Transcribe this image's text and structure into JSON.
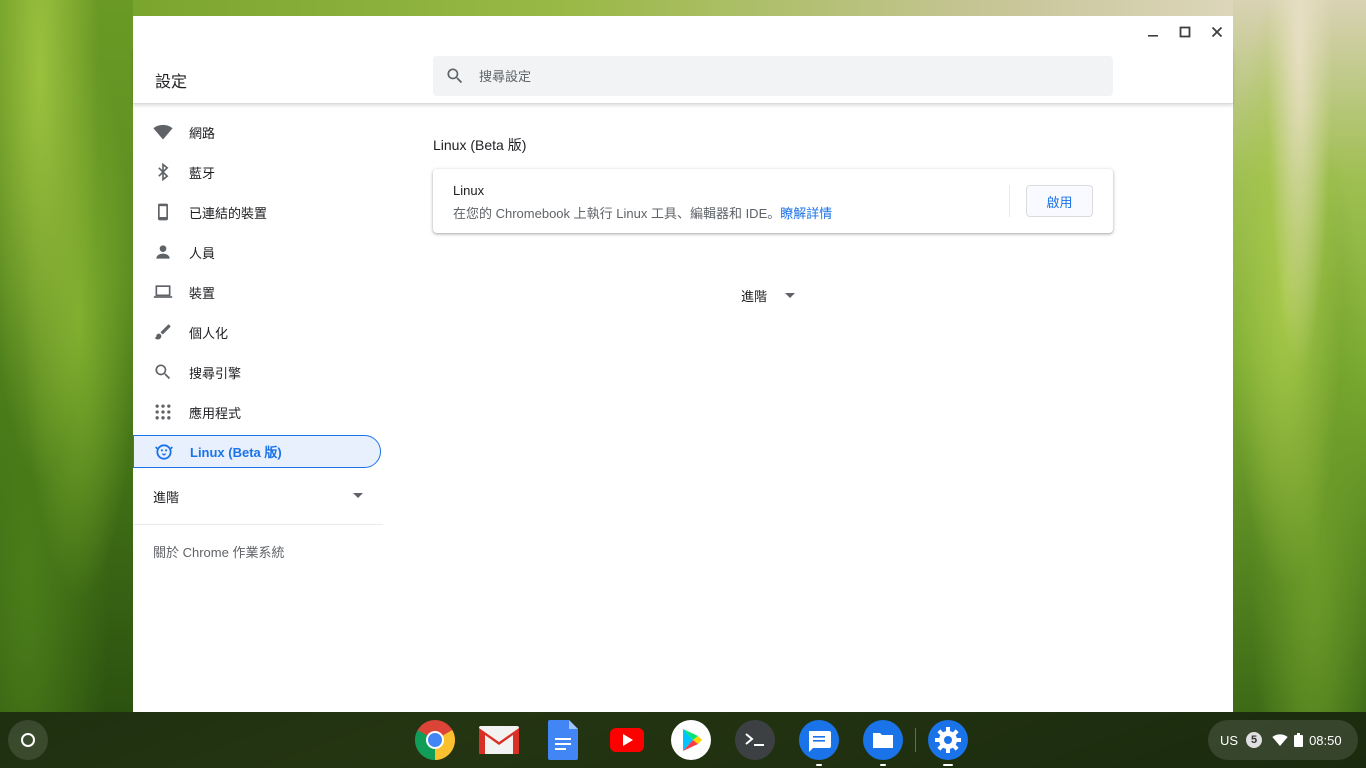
{
  "window": {
    "app_title": "設定",
    "search_placeholder": "搜尋設定",
    "controls": [
      "minimize",
      "maximize",
      "close"
    ]
  },
  "sidebar": {
    "items": [
      {
        "label": "網路",
        "icon": "wifi-icon"
      },
      {
        "label": "藍牙",
        "icon": "bluetooth-icon"
      },
      {
        "label": "已連結的裝置",
        "icon": "phone-icon"
      },
      {
        "label": "人員",
        "icon": "person-icon"
      },
      {
        "label": "裝置",
        "icon": "laptop-icon"
      },
      {
        "label": "個人化",
        "icon": "brush-icon"
      },
      {
        "label": "搜尋引擎",
        "icon": "search-icon"
      },
      {
        "label": "應用程式",
        "icon": "apps-grid-icon"
      },
      {
        "label": "Linux (Beta 版)",
        "icon": "penguin-icon",
        "selected": true
      }
    ],
    "advanced_label": "進階",
    "about_label": "關於 Chrome 作業系統"
  },
  "main": {
    "section_title": "Linux (Beta 版)",
    "card": {
      "title": "Linux",
      "description": "在您的 Chromebook 上執行 Linux 工具、編輯器和 IDE。",
      "learn_more": "瞭解詳情",
      "enable_button": "啟用"
    },
    "advanced_toggle": "進階"
  },
  "shelf": {
    "apps": [
      "chrome-icon",
      "gmail-icon",
      "docs-icon",
      "youtube-icon",
      "play-store-icon",
      "terminal-icon",
      "messages-icon",
      "files-icon",
      "settings-icon"
    ],
    "tray": {
      "ime": "US",
      "notification_count": "5",
      "time": "08:50"
    }
  },
  "colors": {
    "accent": "#1a73e8",
    "selected_bg": "#e8f0fe",
    "text_primary": "#202124",
    "text_secondary": "#5f6368"
  }
}
